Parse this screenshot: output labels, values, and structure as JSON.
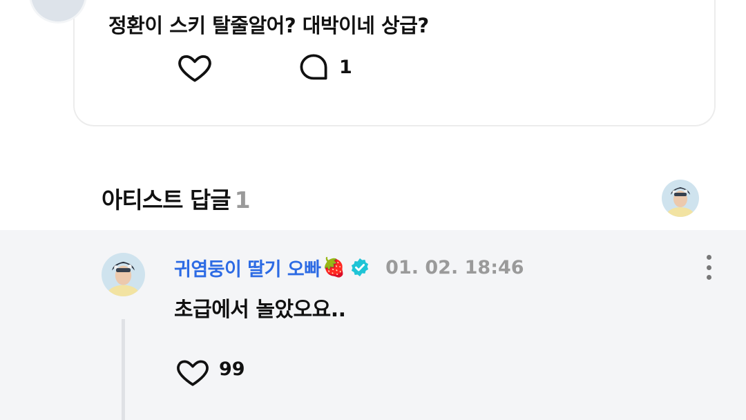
{
  "post": {
    "text": "정환이 스키 탈줄알어? 대박이네 상급?",
    "like_icon": "heart-outline-icon",
    "comment_icon": "comment-bubble-icon",
    "comment_count": "1"
  },
  "artist_replies": {
    "title": "아티스트 답글",
    "count": "1",
    "thumbnail_icon": "artist-avatar"
  },
  "reply": {
    "author": "귀염둥이 딸기 오빠",
    "emoji": "🍓",
    "verified_icon": "verified-badge-icon",
    "time": "01. 02. 18:46",
    "text": "초급에서 놀았오요..",
    "like_count": "99",
    "more_icon": "more-vertical-icon"
  },
  "colors": {
    "author_blue": "#2d6be4",
    "verified_cyan": "#1fc4d6",
    "muted_gray": "#9a9a9a",
    "reply_background": "#f4f5f7"
  }
}
